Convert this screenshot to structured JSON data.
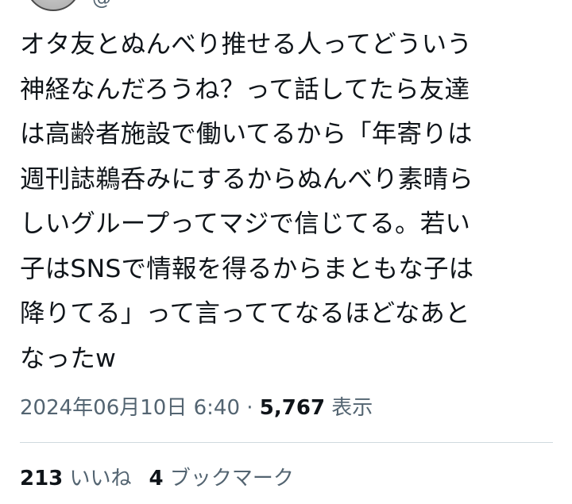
{
  "author": {
    "handle_fragment": "@"
  },
  "tweet": {
    "lines": [
      "オタ友とぬんべり推せる人ってどういう",
      "神経なんだろうね？って話してたら友達",
      "は高齢者施設で働いてるから「年寄りは",
      "週刊誌鵜呑みにするからぬんべり素晴ら",
      "しいグループってマジで信じてる。若い",
      "子はSNSで情報を得るからまともな子は",
      "降りてる」って言っててなるほどなあと",
      "なったw"
    ]
  },
  "meta": {
    "timestamp": "2024年06月10日 6:40",
    "separator": " · ",
    "views_count": "5,767",
    "views_label": " 表示"
  },
  "stats": {
    "likes_count": "213",
    "likes_label": " いいね",
    "bookmarks_count": "4",
    "bookmarks_label": " ブックマーク"
  }
}
